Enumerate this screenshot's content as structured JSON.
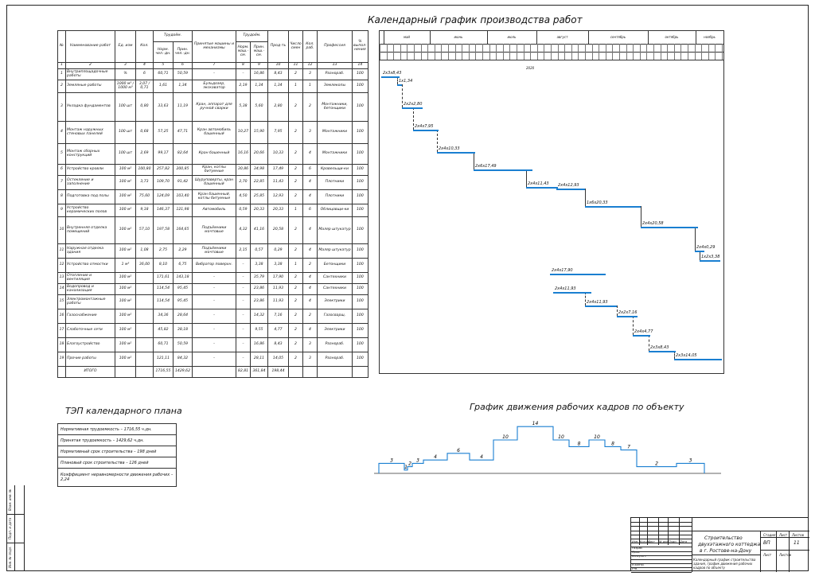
{
  "gantt_title": "Календарный график производства работ",
  "workforce_title": "График движения рабочих кадров по объекту",
  "tep_title": "ТЭП календарного плана",
  "table": {
    "headers": {
      "num": "№",
      "name": "Наименование работ",
      "unit": "Ед. изм",
      "qty": "Кол.",
      "labor_group": "Трудоём.",
      "labor_norm": "Норм. чел.-дн.",
      "labor_acc": "Прин. чел.-дн.",
      "machines": "Принятые машины и механизмы",
      "mach_group": "Трудоём.",
      "mach_norm": "Норм. маш.-см.",
      "mach_acc": "Прин. маш.-см.",
      "duration": "Прод-ть",
      "shifts": "Число смен",
      "workers": "Кол. раб.",
      "profession": "Профессия",
      "percent": "% выпол-нения"
    },
    "colnums": [
      "1",
      "2",
      "3",
      "4",
      "5",
      "6",
      "7",
      "8",
      "9",
      "10",
      "11",
      "12",
      "13",
      "14"
    ],
    "rows": [
      {
        "n": "1",
        "name": "Внутриплощадочные работы",
        "unit": "%",
        "qty": "6",
        "ln": "60,71",
        "la": "50,59",
        "mach": "–",
        "mn": "–",
        "ma": "16,86",
        "d": "8,43",
        "s": "2",
        "w": "3",
        "prof": "Разнораб.",
        "p": "100"
      },
      {
        "n": "2",
        "name": "Земляные работы",
        "unit": "1000 м³ / 1000 м³",
        "qty": "3,07 / 0,71",
        "ln": "1,61",
        "la": "1,34",
        "mach": "Бульдозер, экскаватор",
        "mn": "2,19",
        "ma": "1,34",
        "d": "1,34",
        "s": "1",
        "w": "1",
        "prof": "Землекопы",
        "p": "100"
      },
      {
        "n": "3",
        "name": "Укладка фундаментов",
        "unit": "100 шт",
        "qty": "0,80",
        "ln": "33,63",
        "la": "11,19",
        "mach": "Кран, аппарат для ручной сварки",
        "mn": "5,38",
        "ma": "5,60",
        "d": "2,80",
        "s": "2",
        "w": "2",
        "prof": "Монтажники, бетонщики",
        "p": "100"
      },
      {
        "n": "4",
        "name": "Монтаж наружных стеновых панелей",
        "unit": "100 шт",
        "qty": "0,68",
        "ln": "57,25",
        "la": "47,71",
        "mach": "Кран автомобиль башенный",
        "mn": "10,27",
        "ma": "15,90",
        "d": "7,95",
        "s": "2",
        "w": "3",
        "prof": "Монтажники",
        "p": "100"
      },
      {
        "n": "5",
        "name": "Монтаж сборных конструкций",
        "unit": "100 шт",
        "qty": "2,69",
        "ln": "99,17",
        "la": "82,64",
        "mach": "Кран башенный",
        "mn": "16,16",
        "ma": "20,66",
        "d": "10,33",
        "s": "2",
        "w": "4",
        "prof": "Монтажники",
        "p": "100"
      },
      {
        "n": "6",
        "name": "Устройство кровли",
        "unit": "100 м²",
        "qty": "100,80",
        "ln": "257,82",
        "la": "200,85",
        "mach": "Кран, котлы битумные",
        "mn": "30,86",
        "ma": "34,98",
        "d": "17,49",
        "s": "2",
        "w": "6",
        "prof": "Кровельщи-ки",
        "p": "100"
      },
      {
        "n": "7",
        "name": "Остекление и заполнение",
        "unit": "100 м²",
        "qty": "3,73",
        "ln": "109,70",
        "la": "91,42",
        "mach": "Шуруповерты, кран башенный",
        "mn": "2,70",
        "ma": "22,85",
        "d": "11,43",
        "s": "2",
        "w": "4",
        "prof": "Плотники",
        "p": "100"
      },
      {
        "n": "8",
        "name": "Подготовка под полы",
        "unit": "100 м²",
        "qty": "75,60",
        "ln": "124,09",
        "la": "103,40",
        "mach": "Кран башенный, котлы битумные",
        "mn": "4,50",
        "ma": "25,85",
        "d": "12,93",
        "s": "2",
        "w": "4",
        "prof": "Плотники",
        "p": "100"
      },
      {
        "n": "9",
        "name": "Устройство керамических полов",
        "unit": "100 м²",
        "qty": "9,18",
        "ln": "146,37",
        "la": "121,98",
        "mach": "Автомобиль",
        "mn": "0,59",
        "ma": "20,33",
        "d": "20,33",
        "s": "1",
        "w": "6",
        "prof": "Облицовщи-ки",
        "p": "100"
      },
      {
        "n": "10",
        "name": "Внутренняя отделка помещений",
        "unit": "100 м²",
        "qty": "57,10",
        "ln": "197,58",
        "la": "164,65",
        "mach": "Подъёмники мачтовые",
        "mn": "4,32",
        "ma": "41,16",
        "d": "20,58",
        "s": "2",
        "w": "4",
        "prof": "Маляр штукатур",
        "p": "100"
      },
      {
        "n": "11",
        "name": "Наружная отделка здания",
        "unit": "100 м²",
        "qty": "1,08",
        "ln": "2,75",
        "la": "2,29",
        "mach": "Подъёмники мачтовые",
        "mn": "2,15",
        "ma": "0,57",
        "d": "0,29",
        "s": "2",
        "w": "4",
        "prof": "Маляр штукатур",
        "p": "100"
      },
      {
        "n": "12",
        "name": "Устройство отмостки",
        "unit": "1 м³",
        "qty": "36,00",
        "ln": "8,10",
        "la": "6,75",
        "mach": "Вибратор поверхн.",
        "mn": "–",
        "ma": "3,38",
        "d": "3,38",
        "s": "1",
        "w": "2",
        "prof": "Бетонщики",
        "p": "100"
      },
      {
        "n": "13",
        "name": "Отопление и вентиляция",
        "unit": "100 м²",
        "qty": "",
        "ln": "171,61",
        "la": "143,18",
        "mach": "–",
        "mn": "–",
        "ma": "35,79",
        "d": "17,90",
        "s": "2",
        "w": "4",
        "prof": "Сантехники",
        "p": "100"
      },
      {
        "n": "14",
        "name": "Водопровод и канализация",
        "unit": "100 м²",
        "qty": "",
        "ln": "114,54",
        "la": "95,45",
        "mach": "–",
        "mn": "–",
        "ma": "23,86",
        "d": "11,93",
        "s": "2",
        "w": "4",
        "prof": "Сантехники",
        "p": "100"
      },
      {
        "n": "15",
        "name": "Электромонтажные работы",
        "unit": "100 м²",
        "qty": "",
        "ln": "114,54",
        "la": "95,45",
        "mach": "–",
        "mn": "–",
        "ma": "23,86",
        "d": "11,93",
        "s": "2",
        "w": "4",
        "prof": "Электрики",
        "p": "100"
      },
      {
        "n": "16",
        "name": "Газоснабжение",
        "unit": "100 м²",
        "qty": "",
        "ln": "34,36",
        "la": "28,64",
        "mach": "–",
        "mn": "–",
        "ma": "14,32",
        "d": "7,16",
        "s": "2",
        "w": "2",
        "prof": "Газосварщ.",
        "p": "100"
      },
      {
        "n": "17",
        "name": "Слаботочные сети",
        "unit": "100 м²",
        "qty": "",
        "ln": "45,82",
        "la": "38,18",
        "mach": "–",
        "mn": "–",
        "ma": "9,55",
        "d": "4,77",
        "s": "2",
        "w": "4",
        "prof": "Электрики",
        "p": "100"
      },
      {
        "n": "18",
        "name": "Благоустройство",
        "unit": "100 м²",
        "qty": "",
        "ln": "60,71",
        "la": "50,59",
        "mach": "–",
        "mn": "–",
        "ma": "16,86",
        "d": "8,43",
        "s": "2",
        "w": "3",
        "prof": "Разнораб.",
        "p": "100"
      },
      {
        "n": "19",
        "name": "Прочие работы",
        "unit": "100 м²",
        "qty": "",
        "ln": "121,11",
        "la": "84,32",
        "mach": "–",
        "mn": "–",
        "ma": "28,11",
        "d": "14,05",
        "s": "2",
        "w": "3",
        "prof": "Разнораб.",
        "p": "100"
      }
    ],
    "total": {
      "label": "ИТОГО",
      "ln": "1716,55",
      "la": "1429,62",
      "mn": "82,81",
      "ma": "361,84",
      "d": "198,44"
    }
  },
  "gantt": {
    "months": [
      "",
      "май",
      "июнь",
      "июль",
      "август",
      "сентябрь",
      "октябрь",
      "ноябрь"
    ],
    "year_label": "2020",
    "bar_labels": [
      "2х3х8,43",
      "1х1,34",
      "2х2х2,80",
      "2х4х7,95",
      "2х4х10,33",
      "2х6х17,49",
      "2х4х11,43",
      "2х4х12,93",
      "1х6х20,33",
      "2х4х20,58",
      "2х4х0,29",
      "1х2х3,38",
      "2х4х17,90",
      "2х4х11,93",
      "2х4х11,93",
      "2х2х7,16",
      "2х4х4,77",
      "2х3х8,43",
      "2х3х14,05"
    ]
  },
  "workforce": {
    "step_labels": [
      "3",
      "1",
      "2",
      "3",
      "4",
      "6",
      "4",
      "10",
      "14",
      "10",
      "8",
      "10",
      "8",
      "7",
      "2",
      "3"
    ]
  },
  "tep": [
    "Нормативная трудоемкость – 1716,55 ч.дн.",
    "Принятая трудоемкость – 1429,62 ч.дн.",
    "Нормативный срок строительства – 198 дней",
    "Плановый срок строительства – 126 дней",
    "Коэффициент неравномерности движения рабочих – 2,24"
  ],
  "stamp": {
    "project_line1": "Строительство",
    "project_line2": "двухэтажного коттеджа",
    "project_line3": "в г. Ростове-на-Дону",
    "sheet_desc": "Календарный график строительства здания, график движения рабочих кадров по объекту",
    "stage": "ВП",
    "sheet": "11",
    "h_stage": "Стадия",
    "h_sheet": "Лист",
    "h_sheets": "Листов",
    "roles": [
      "Изм.",
      "Кол.уч.",
      "Лист",
      "№ док.",
      "Подп.",
      "Дата"
    ],
    "people": [
      "Разраб.",
      "Пров.",
      "Консульт.",
      "",
      "Н.контр.",
      "Утв."
    ]
  },
  "strip": [
    "Инв. № подл.",
    "Подп. и дата",
    "Взам. инв. №"
  ]
}
